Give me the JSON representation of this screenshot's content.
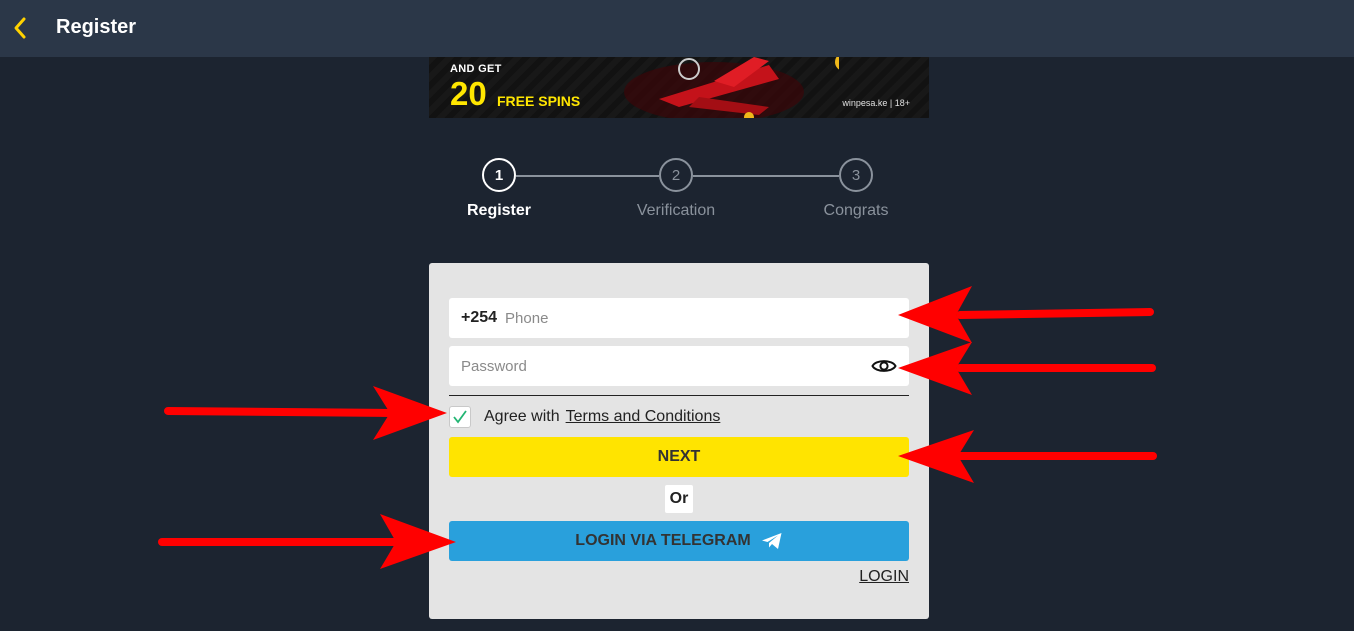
{
  "header": {
    "title": "Register",
    "back_icon": "chevron-left-icon"
  },
  "banner": {
    "line1": "AND GET",
    "number": "20",
    "line2": "FREE SPINS",
    "site": "winpesa.ke | 18+"
  },
  "steps": [
    {
      "number": "1",
      "label": "Register",
      "active": true
    },
    {
      "number": "2",
      "label": "Verification",
      "active": false
    },
    {
      "number": "3",
      "label": "Congrats",
      "active": false
    }
  ],
  "form": {
    "phone_prefix": "+254",
    "phone_placeholder": "Phone",
    "password_placeholder": "Password",
    "agree_text": "Agree with",
    "terms_link": "Terms and Conditions",
    "agree_checked": true,
    "next_label": "NEXT",
    "or_label": "Or",
    "telegram_label": "LOGIN VIA TELEGRAM",
    "login_link": "LOGIN"
  },
  "colors": {
    "accent_yellow": "#ffe400",
    "telegram_blue": "#29a0dc",
    "annotation_red": "#ff0000"
  }
}
